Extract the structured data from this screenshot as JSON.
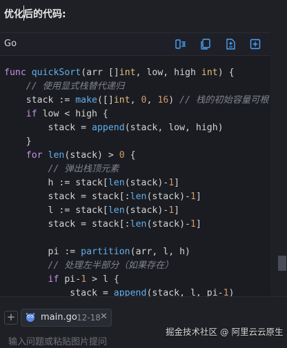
{
  "header": {
    "title": "优化后的代码:"
  },
  "code_block": {
    "language": "Go",
    "toolbar": [
      {
        "name": "insert-icon"
      },
      {
        "name": "copy-icon"
      },
      {
        "name": "diff-icon"
      },
      {
        "name": "new-file-icon"
      }
    ],
    "lines": [
      "func quickSort(arr []int, low, high int) {",
      "    // 使用显式栈替代递归",
      "    stack := make([]int, 0, 16) // 栈的初始容量可根",
      "    if low < high {",
      "        stack = append(stack, low, high)",
      "    }",
      "    for len(stack) > 0 {",
      "        // 弹出栈顶元素",
      "        h := stack[len(stack)-1]",
      "        stack = stack[:len(stack)-1]",
      "        l := stack[len(stack)-1]",
      "        stack = stack[:len(stack)-1]",
      "",
      "        pi := partition(arr, l, h)",
      "        // 处理左半部分（如果存在）",
      "        if pi-1 > l {",
      "            stack = append(stack, l, pi-1)"
    ]
  },
  "context_chip": {
    "file": "main.go",
    "range": "12-18"
  },
  "input": {
    "placeholder": "输入问题或粘贴图片提问"
  },
  "watermark": "掘金技术社区 @ 阿里云云原生"
}
